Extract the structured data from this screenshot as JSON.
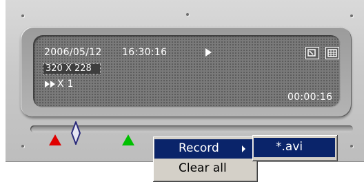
{
  "display": {
    "date": "2006/05/12",
    "time": "16:30:16",
    "resolution": "320 X 228",
    "speed": "X 1",
    "elapsed": "00:00:16"
  },
  "icons": {
    "play": "play-icon",
    "fast_forward": "fast-forward-icon",
    "restore": "restore-window-icon",
    "grid": "grid-view-icon",
    "thumb": "slider-thumb-icon",
    "start_marker": "start-marker-icon",
    "end_marker": "end-marker-icon",
    "submenu": "submenu-arrow-icon"
  },
  "menu": {
    "items": [
      {
        "label": "Record"
      },
      {
        "label": "Clear all"
      }
    ],
    "submenu": [
      {
        "label": "*.avi"
      }
    ]
  },
  "colors": {
    "menu_highlight": "#0a246a",
    "start_marker": "#e00000",
    "end_marker": "#00c000"
  }
}
